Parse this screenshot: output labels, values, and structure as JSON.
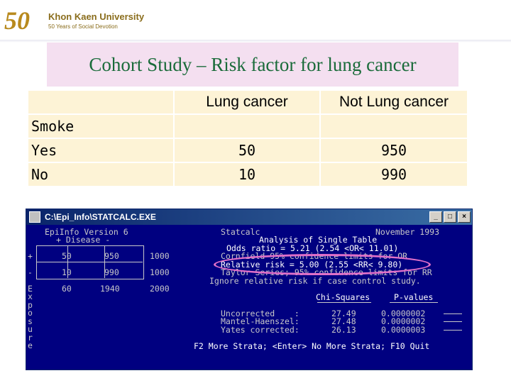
{
  "logo": {
    "number": "50",
    "university": "Khon Kaen University",
    "subtitle": "50 Years of Social Devotion"
  },
  "slide_title": "Cohort Study – Risk factor for lung cancer",
  "table": {
    "headers": [
      "",
      "Lung cancer",
      "Not Lung cancer"
    ],
    "row_group_label": "Smoke",
    "rows": [
      {
        "label": "Yes",
        "values": [
          "50",
          "950"
        ]
      },
      {
        "label": "No",
        "values": [
          "10",
          "990"
        ]
      }
    ]
  },
  "window": {
    "title": "C:\\Epi_Info\\STATCALC.EXE",
    "buttons": [
      "_",
      "□",
      "×"
    ]
  },
  "console": {
    "version": "EpiInfo Version 6",
    "app": "Statcalc",
    "date": "November 1993",
    "disease_header": "+ Disease -",
    "analysis_title": "Analysis of Single Table",
    "exposure_rows": [
      {
        "sign": "+",
        "a": "50",
        "b": "950",
        "total": "1000"
      },
      {
        "sign": "-",
        "a": "10",
        "b": "990",
        "total": "1000"
      }
    ],
    "totals": {
      "a": "60",
      "b": "1940",
      "total": "2000"
    },
    "exposure_vertical": [
      "E",
      "x",
      "p",
      "o",
      "s",
      "u",
      "r",
      "e"
    ],
    "odds_ratio": "Odds ratio = 5.21 (2.54 <OR< 11.01)",
    "cornfield": "Cornfield 95% confidence limits for OR",
    "relative_risk": "Relative risk = 5.00 (2.55 <RR< 9.80)",
    "taylor": "Taylor Series; 95% confidence limits for RR",
    "ignore": "Ignore relative risk if case control study.",
    "chi_header": "Chi-Squares",
    "p_header": "P-values",
    "chi_rows": [
      {
        "label": "Uncorrected    :",
        "chi": "27.49",
        "p": "0.0000002"
      },
      {
        "label": "Mantel-Haenszel:",
        "chi": "27.48",
        "p": "0.0000002"
      },
      {
        "label": "Yates corrected:",
        "chi": "26.13",
        "p": "0.0000003"
      }
    ],
    "footer": "F2 More Strata; <Enter> No More Strata; F10 Quit"
  }
}
